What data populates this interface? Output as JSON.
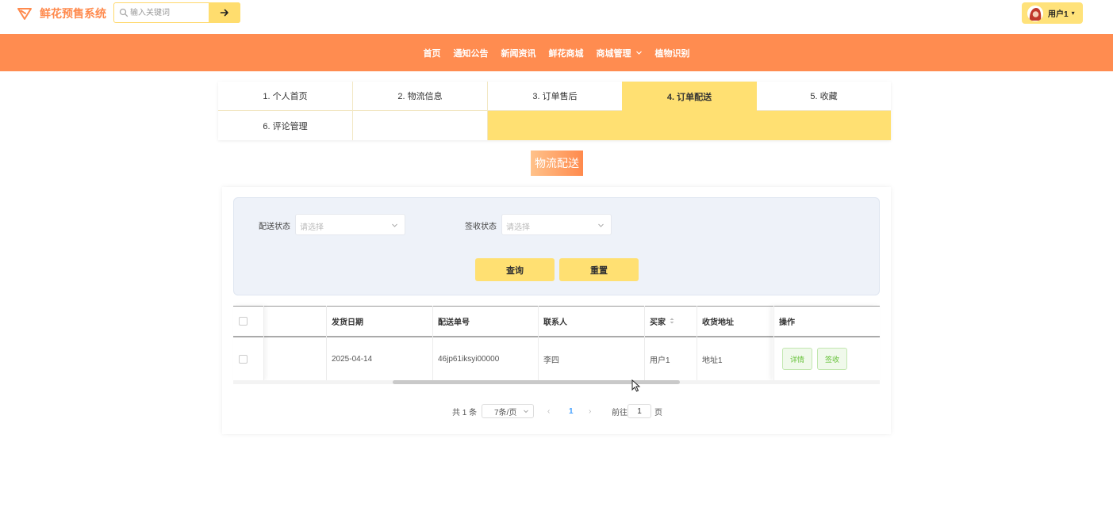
{
  "app": {
    "title": "鲜花预售系统",
    "brand_color": "#ff8a4d"
  },
  "search": {
    "placeholder": "输入关键词",
    "button_icon": "arrow-right-icon"
  },
  "user": {
    "name": "用户1",
    "caret": "▾"
  },
  "nav": {
    "items": [
      {
        "label": "首页"
      },
      {
        "label": "通知公告"
      },
      {
        "label": "新闻资讯"
      },
      {
        "label": "鲜花商城"
      },
      {
        "label": "商城管理",
        "has_dropdown": true
      },
      {
        "label": "植物识别"
      }
    ],
    "bg": "#ff8c50"
  },
  "tabs": [
    {
      "label": "1. 个人首页"
    },
    {
      "label": "2. 物流信息"
    },
    {
      "label": "3. 订单售后"
    },
    {
      "label": "4. 订单配送",
      "active": true
    },
    {
      "label": "5. 收藏"
    },
    {
      "label": "6. 评论管理"
    }
  ],
  "section_title": "物流配送",
  "filters": {
    "delivery_status": {
      "label": "配送状态",
      "placeholder": "请选择"
    },
    "sign_status": {
      "label": "签收状态",
      "placeholder": "请选择"
    },
    "query_button": "查询",
    "reset_button": "重置"
  },
  "table": {
    "columns": [
      "发货日期",
      "配送单号",
      "联系人",
      "买家",
      "收货地址",
      "操作"
    ],
    "rows": [
      {
        "ship_date": "2025-04-14",
        "delivery_no": "46jp61iksyi00000",
        "contact": "李四",
        "buyer": "用户1",
        "address": "地址1",
        "actions": [
          "详情",
          "签收"
        ]
      }
    ]
  },
  "pagination": {
    "total": "共 1 条",
    "page_size": "7条/页",
    "prev": "‹",
    "current": "1",
    "next": "›",
    "goto_label": "前往",
    "goto_value": "1",
    "page_suffix": "页"
  },
  "colors": {
    "accent_yellow": "#ffe072",
    "action_green": "#67c23a"
  }
}
